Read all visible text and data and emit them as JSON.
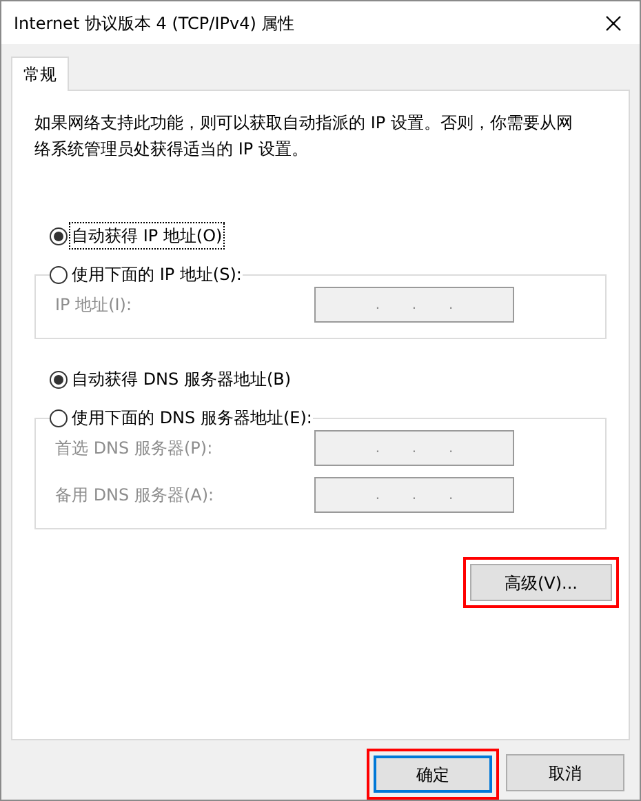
{
  "window": {
    "title": "Internet 协议版本 4 (TCP/IPv4) 属性"
  },
  "tabs": [
    {
      "label": "常规",
      "selected": true
    }
  ],
  "description": "如果网络支持此功能，则可以获取自动指派的 IP 设置。否则，你需要从网络系统管理员处获得适当的 IP 设置。",
  "sections": [
    {
      "auto_option": {
        "label": "自动获得 IP 地址(O)",
        "selected": true,
        "focused": true
      },
      "manual_option": {
        "label": "使用下面的 IP 地址(S):",
        "selected": false,
        "focused": false
      },
      "fields": [
        {
          "label": "IP 地址(I):",
          "disabled": true,
          "separators": [
            ".",
            ".",
            "."
          ]
        }
      ]
    },
    {
      "auto_option": {
        "label": "自动获得 DNS 服务器地址(B)",
        "selected": true,
        "focused": false
      },
      "manual_option": {
        "label": "使用下面的 DNS 服务器地址(E):",
        "selected": false,
        "focused": false
      },
      "fields": [
        {
          "label": "首选 DNS 服务器(P):",
          "disabled": true,
          "separators": [
            ".",
            ".",
            "."
          ]
        },
        {
          "label": "备用 DNS 服务器(A):",
          "disabled": true,
          "separators": [
            ".",
            ".",
            "."
          ]
        }
      ]
    }
  ],
  "advanced_button": {
    "label": "高级(V)...",
    "highlighted": true
  },
  "footer_buttons": [
    {
      "label": "确定",
      "default": true,
      "highlighted": true
    },
    {
      "label": "取消",
      "default": false,
      "highlighted": false
    }
  ]
}
